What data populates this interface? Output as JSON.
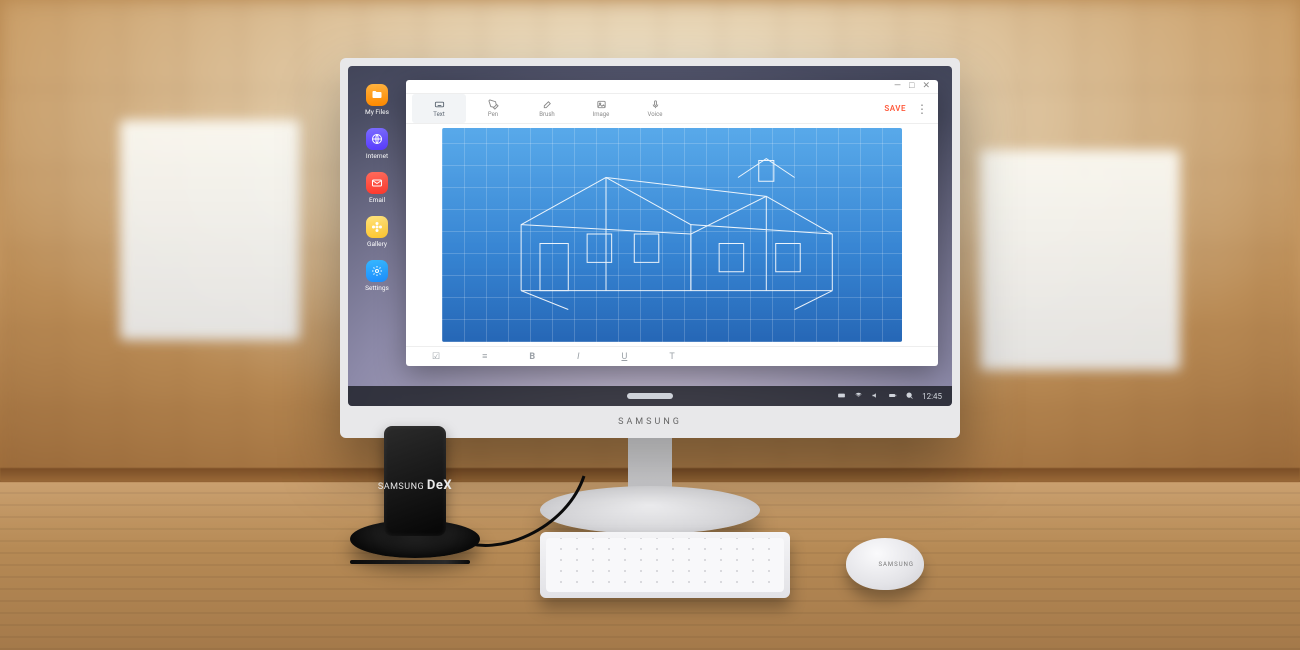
{
  "monitor": {
    "brand": "SAMSUNG"
  },
  "desktop": {
    "icons": [
      {
        "id": "my-files",
        "label": "My Files"
      },
      {
        "id": "internet",
        "label": "Internet"
      },
      {
        "id": "email",
        "label": "Email"
      },
      {
        "id": "gallery",
        "label": "Gallery"
      },
      {
        "id": "settings",
        "label": "Settings"
      }
    ]
  },
  "taskbar": {
    "time": "12:45"
  },
  "app": {
    "window_controls": {
      "minimize": "—",
      "maximize": "□",
      "close": "✕"
    },
    "tools": [
      {
        "id": "text",
        "label": "Text",
        "active": true
      },
      {
        "id": "pen",
        "label": "Pen",
        "active": false
      },
      {
        "id": "brush",
        "label": "Brush",
        "active": false
      },
      {
        "id": "image",
        "label": "Image",
        "active": false
      },
      {
        "id": "voice",
        "label": "Voice",
        "active": false
      }
    ],
    "save_label": "SAVE",
    "more_label": "⋮",
    "formatbar": {
      "checklist": "☑",
      "list": "≡",
      "bold": "B",
      "italic": "I",
      "underline": "U",
      "textcolor": "T"
    }
  },
  "peripherals": {
    "dex_brand_small": "SAMSUNG",
    "dex_brand_big": "DeX",
    "mouse_brand": "SAMSUNG"
  }
}
